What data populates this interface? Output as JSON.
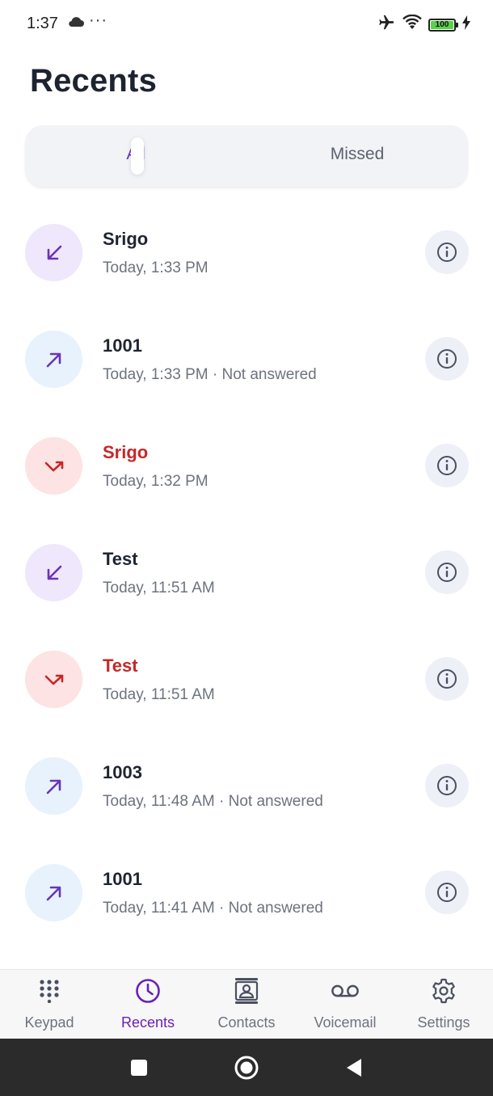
{
  "status_bar": {
    "time": "1:37",
    "dots": "···",
    "battery": "100",
    "icons": [
      "cloud-icon",
      "airplane-icon",
      "wifi-icon",
      "battery-icon",
      "charging-icon"
    ]
  },
  "page": {
    "title": "Recents"
  },
  "tabs": [
    {
      "label": "All",
      "active": true
    },
    {
      "label": "Missed",
      "active": false
    }
  ],
  "colors": {
    "accent": "#6a35b8",
    "missed": "#c62828",
    "incoming_bg": "#efe7fb",
    "outgoing_bg": "#e7f2fd",
    "missed_bg": "#fde3e3"
  },
  "calls": [
    {
      "name": "Srigo",
      "detail": "Today, 1:33 PM",
      "type": "incoming"
    },
    {
      "name": "1001",
      "detail": "Today, 1:33 PM · Not answered",
      "type": "outgoing"
    },
    {
      "name": "Srigo",
      "detail": "Today, 1:32 PM",
      "type": "missed"
    },
    {
      "name": "Test",
      "detail": "Today, 11:51 AM",
      "type": "incoming"
    },
    {
      "name": "Test",
      "detail": "Today, 11:51 AM",
      "type": "missed"
    },
    {
      "name": "1003",
      "detail": "Today, 11:48 AM · Not answered",
      "type": "outgoing"
    },
    {
      "name": "1001",
      "detail": "Today, 11:41 AM · Not answered",
      "type": "outgoing"
    }
  ],
  "bottom_nav": [
    {
      "label": "Keypad",
      "icon": "keypad-icon",
      "active": false
    },
    {
      "label": "Recents",
      "icon": "clock-icon",
      "active": true
    },
    {
      "label": "Contacts",
      "icon": "contacts-icon",
      "active": false
    },
    {
      "label": "Voicemail",
      "icon": "voicemail-icon",
      "active": false
    },
    {
      "label": "Settings",
      "icon": "gear-icon",
      "active": false
    }
  ]
}
